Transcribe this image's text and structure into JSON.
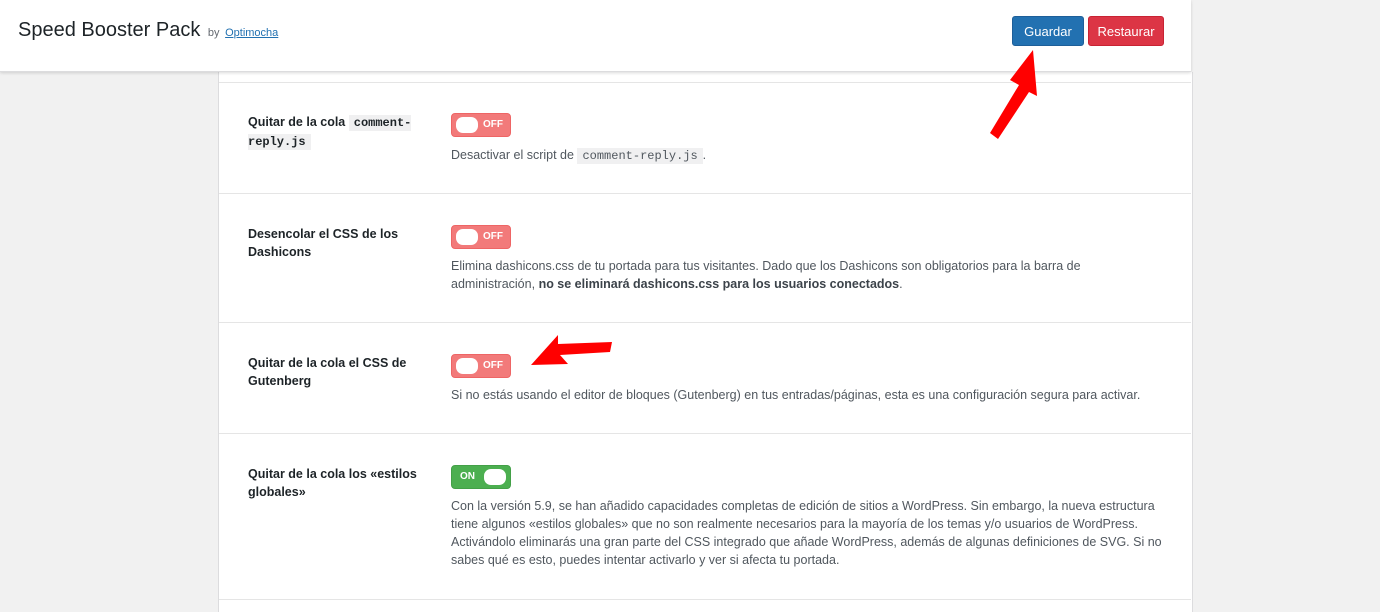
{
  "header": {
    "title": "Speed Booster Pack",
    "by": "by",
    "author": "Optimocha",
    "save_label": "Guardar",
    "reset_label": "Restaurar"
  },
  "colors": {
    "primary": "#2271b1",
    "danger": "#dc3545",
    "toggle_off": "#f27a7a",
    "toggle_on": "#4caf50",
    "annotation_arrow": "#ff0000"
  },
  "settings": [
    {
      "label_prefix": "Quitar de la cola",
      "label_code": "comment-reply.js",
      "toggle": "OFF",
      "desc_prefix": "Desactivar el script de",
      "desc_code": "comment-reply.js",
      "desc_suffix": "."
    },
    {
      "label": "Desencolar el CSS de los Dashicons",
      "toggle": "OFF",
      "desc": "Elimina dashicons.css de tu portada para tus visitantes. Dado que los Dashicons son obligatorios para la barra de administración,",
      "desc_bold": "no se eliminará dashicons.css para los usuarios conectados",
      "desc_suffix": "."
    },
    {
      "label": "Quitar de la cola el CSS de Gutenberg",
      "toggle": "OFF",
      "desc": "Si no estás usando el editor de bloques (Gutenberg) en tus entradas/páginas, esta es una configuración segura para activar."
    },
    {
      "label": "Quitar de la cola los «estilos globales»",
      "toggle": "ON",
      "desc": "Con la versión 5.9, se han añadido capacidades completas de edición de sitios a WordPress. Sin embargo, la nueva estructura tiene algunos «estilos globales» que no son realmente necesarios para la mayoría de los temas y/o usuarios de WordPress. Activándolo eliminarás una gran parte del CSS integrado que añade WordPress, además de algunas definiciones de SVG. Si no sabes qué es esto, puedes intentar activarlo y ver si afecta tu portada."
    }
  ]
}
